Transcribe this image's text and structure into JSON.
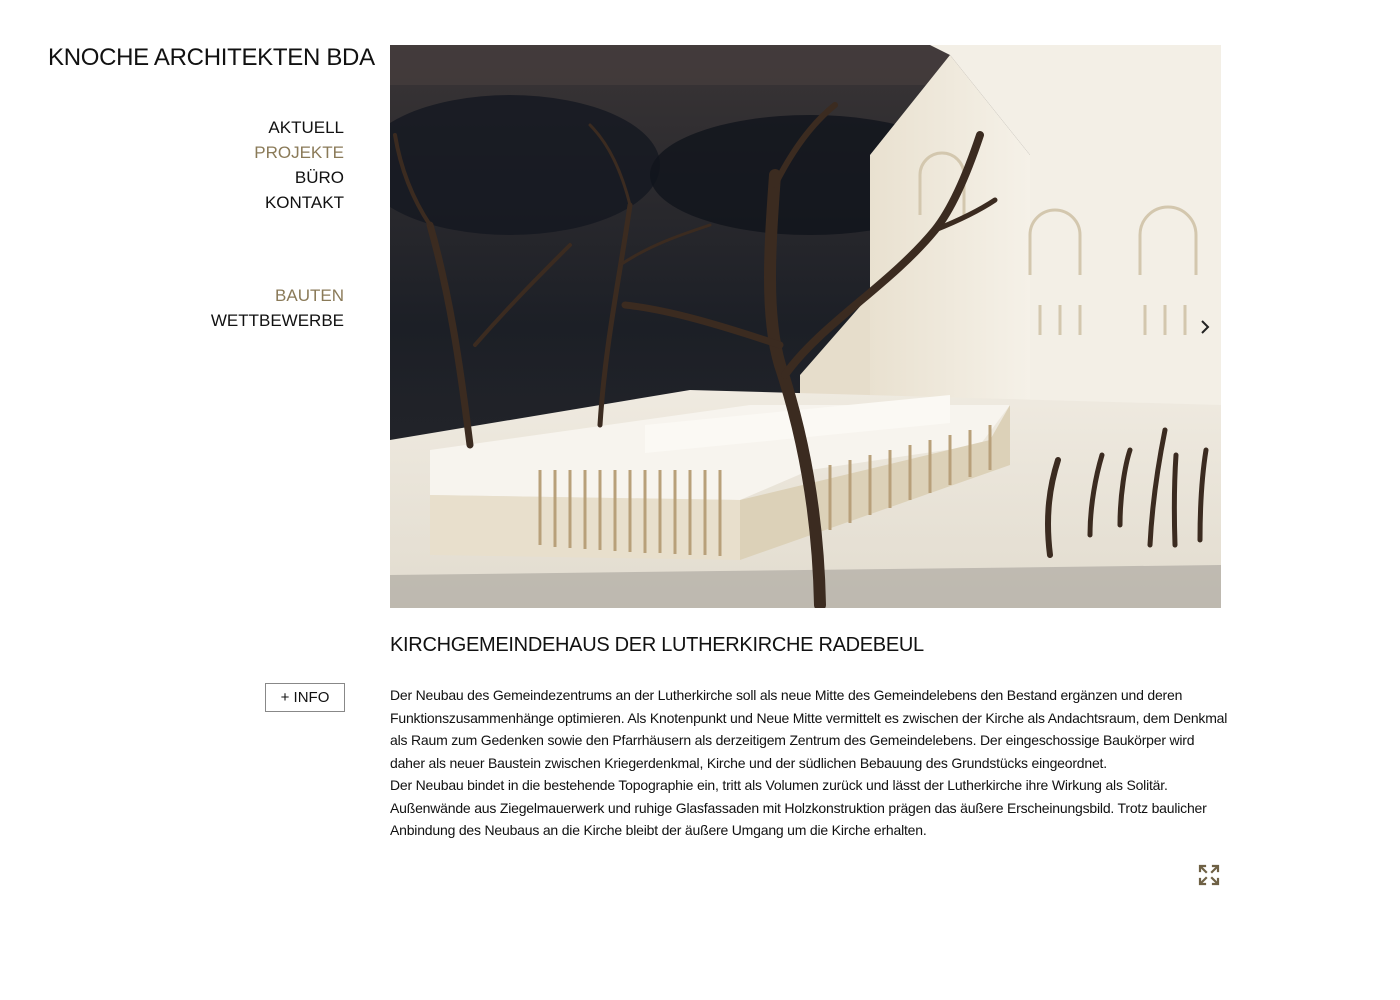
{
  "site": {
    "title": "KNOCHE ARCHITEKTEN BDA"
  },
  "nav": {
    "main": [
      {
        "label": "AKTUELL",
        "active": false
      },
      {
        "label": "PROJEKTE",
        "active": true
      },
      {
        "label": "BÜRO",
        "active": false
      },
      {
        "label": "KONTAKT",
        "active": false
      }
    ],
    "sub": [
      {
        "label": "BAUTEN",
        "active": true
      },
      {
        "label": "WETTBEWERBE",
        "active": false
      }
    ]
  },
  "gallery": {
    "next_icon": "chevron-right-icon"
  },
  "project": {
    "title": "KIRCHGEMEINDEHAUS DER LUTHERKIRCHE RADEBEUL",
    "info_button": "+ INFO",
    "paragraphs": [
      "Der Neubau des Gemeindezentrums an der Lutherkirche soll als neue Mitte des Gemeindelebens den Bestand ergänzen und deren Funktionszusammenhänge optimieren. Als Knotenpunkt und Neue Mitte vermittelt es zwischen der Kirche als Andachtsraum, dem Denkmal als Raum zum Gedenken sowie den Pfarrhäusern als derzeitigem Zentrum des Gemeindelebens. Der eingeschossige Baukörper wird daher als neuer Baustein zwischen Kriegerdenkmal, Kirche und der südlichen Bebauung des Grundstücks eingeordnet.",
      "Der Neubau bindet in die bestehende Topographie ein, tritt als Volumen zurück und lässt der Lutherkirche ihre Wirkung als Solitär. Außenwände aus Ziegelmauerwerk und ruhige Glasfassaden mit Holzkonstruktion prägen das äußere Erscheinungsbild. Trotz baulicher Anbindung des Neubaus an die Kirche bleibt der äußere Umgang um die Kirche erhalten."
    ],
    "fullscreen_icon": "expand-icon"
  },
  "colors": {
    "accent": "#8a7a58",
    "text": "#111111",
    "background": "#ffffff"
  }
}
